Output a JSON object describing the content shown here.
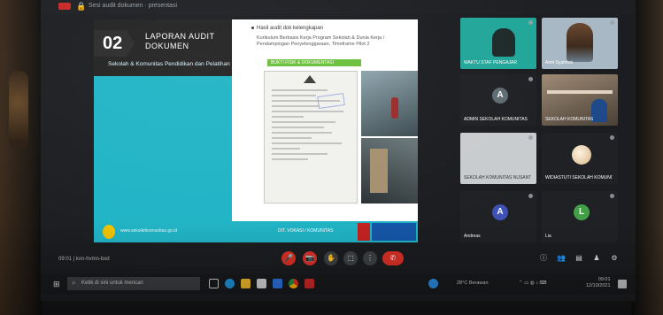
{
  "meeting": {
    "title": "Sesi audit dokumen · presentasi",
    "code": "09:01  |  kxn-hvmn-bxd"
  },
  "slide": {
    "number": "02",
    "title_line1": "LAPORAN AUDIT",
    "title_line2": "DOKUMEN",
    "subtitle": "Sekolah & Komunitas Pendidikan dan Pelatihan",
    "bullet": "Hasil audit dok kelengkapan",
    "sub_bullet": "Kurikulum Berbasis Kerja Program Sekolah & Dunia Kerja / Pendampingan Penyelenggaraan, Timeframe Pilot 2",
    "green_label": "BUKTI FISIK & DOKUMENTASI",
    "footer_text": "www.sekolahkomunitas.go.id",
    "footer_note": "DIT. VOKASI / KOMUNITAS"
  },
  "participants": [
    {
      "name": "WAKTU STAF PENGAJAR",
      "type": "video"
    },
    {
      "name": "Amir Syahroni",
      "type": "video"
    },
    {
      "name": "ADMIN SEKOLAH KOMUNITAS",
      "type": "avatar",
      "initial": "A"
    },
    {
      "name": "SEKOLAH KOMUNITAS",
      "type": "video"
    },
    {
      "name": "SEKOLAH KOMUNITAS NUSANTARA",
      "type": "blank"
    },
    {
      "name": "WIDIASTUTI SEKOLAH KOMUNITAS",
      "type": "avatar-img"
    },
    {
      "name": "Andreas",
      "type": "avatar",
      "initial": "A"
    },
    {
      "name": "Lia",
      "type": "avatar",
      "initial": "L"
    }
  ],
  "controls": {
    "mic": "🎤",
    "camera": "📷",
    "hand": "✋",
    "present": "⬚",
    "more": "⋮",
    "leave": "✆",
    "right": [
      "ⓘ",
      "👥",
      "▤",
      "♟",
      "⚙"
    ]
  },
  "taskbar": {
    "start": "⊞",
    "search_placeholder": "Ketik di sini untuk mencari",
    "tray_text": "28°C Berawan",
    "clock_time": "09:01",
    "clock_date": "12/10/2021"
  },
  "colors": {
    "slide_accent": "#1fb4c6",
    "leave_red": "#d93025",
    "green_label": "#6bbf3a"
  }
}
